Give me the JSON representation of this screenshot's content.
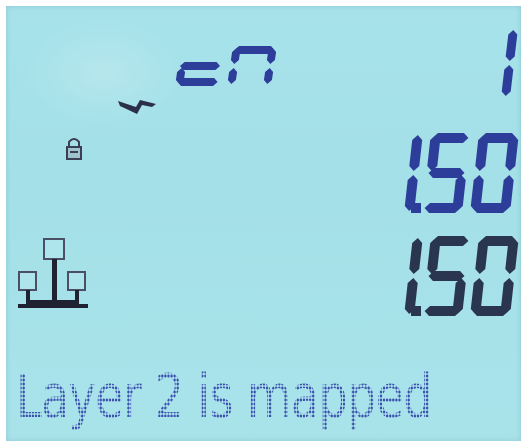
{
  "display": {
    "mode_label": "cn",
    "top_value": "1",
    "value_1": "1.50",
    "value_2": "1.50",
    "status_message": "Layer 2 is mapped"
  },
  "icons": {
    "signal": "lightning-icon",
    "lock": "lock-icon",
    "network": "network-tree-icon"
  },
  "colors": {
    "lcd_background": "#a7e2ea",
    "segment_blue": "#2d3e9a",
    "segment_dark": "#2a3550",
    "message_text": "#3b4fae"
  }
}
